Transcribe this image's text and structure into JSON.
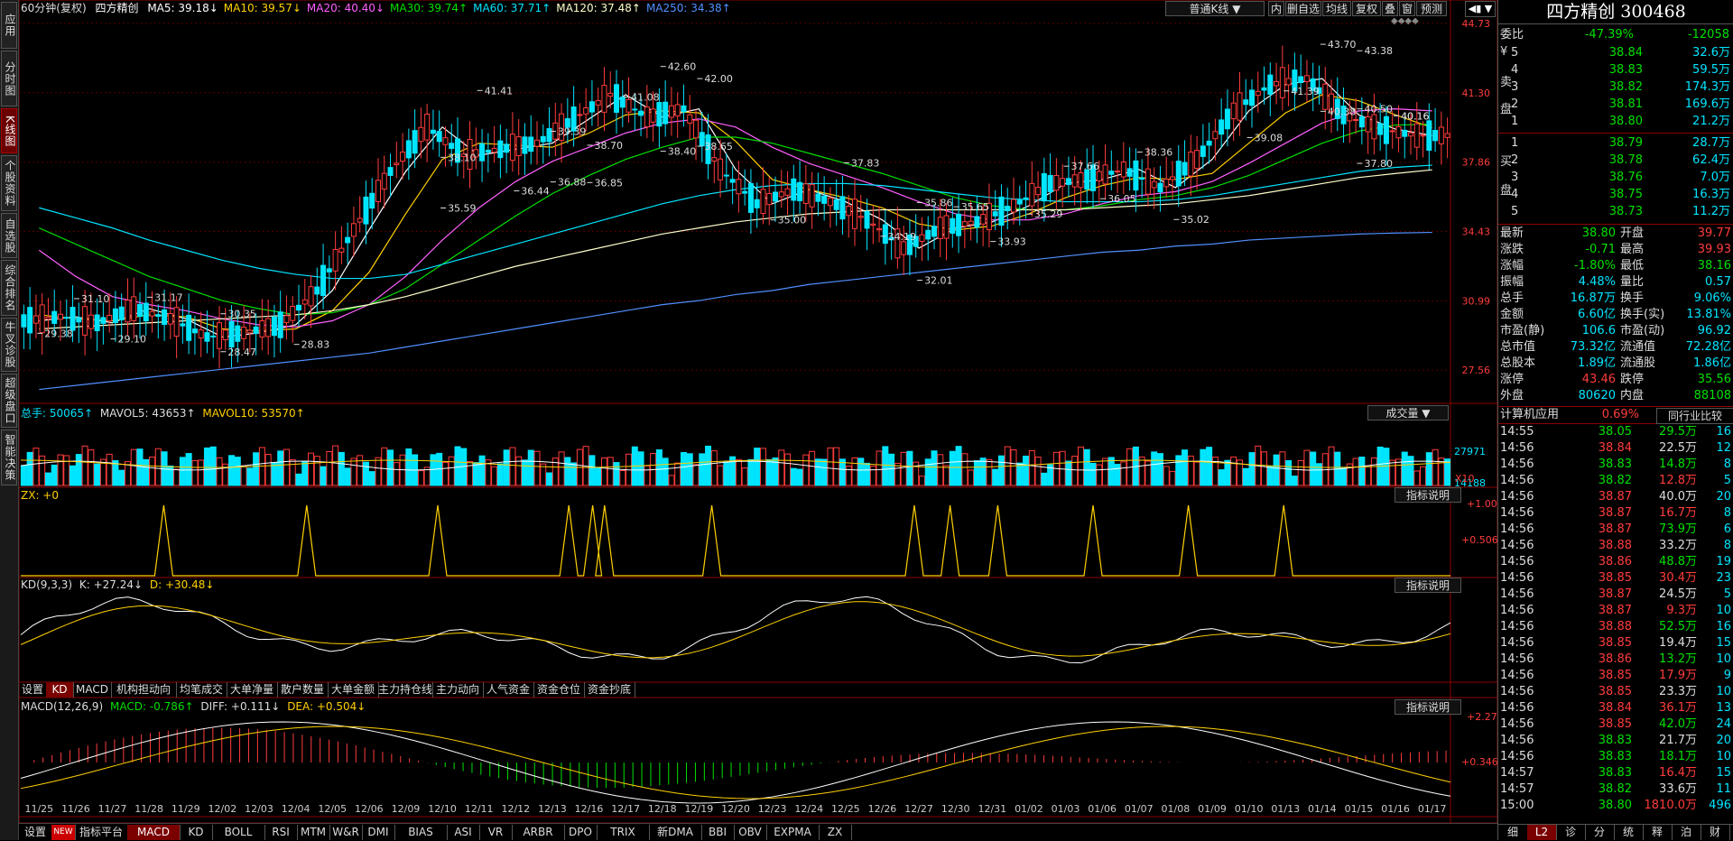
{
  "header": {
    "period": "60分钟(复权)",
    "stock": "四方精创",
    "mas": [
      {
        "label": "MA5: 39.18↓",
        "color": "#ffffff"
      },
      {
        "label": "MA10: 39.57↓",
        "color": "#ffd000"
      },
      {
        "label": "MA20: 40.40↓",
        "color": "#ff60ff"
      },
      {
        "label": "MA30: 39.74↑",
        "color": "#00e000"
      },
      {
        "label": "MA60: 37.71↑",
        "color": "#00e5ff"
      },
      {
        "label": "MA120: 37.48↑",
        "color": "#ffffcc"
      },
      {
        "label": "MA250: 34.38↑",
        "color": "#5090ff"
      }
    ],
    "chart_type": "普通K线",
    "buttons": [
      "内",
      "删自选",
      "均线",
      "复权",
      "叠",
      "窗",
      "预测"
    ],
    "arrow": "◆◆◆◆"
  },
  "left_tabs": [
    "应用",
    "分时图",
    "K线图",
    "个股资料",
    "自选股",
    "综合排名",
    "牛叉诊股",
    "超级盘口",
    "智能决策"
  ],
  "active_left_tab": "K线图",
  "price_axis": [
    "44.73",
    "41.30",
    "37.86",
    "34.43",
    "30.99",
    "27.56"
  ],
  "volume": {
    "label_total": "总手: 50065↑",
    "label_mav5": "MAVOL5: 43653↑",
    "label_mav10": "MAVOL10: 53570↑",
    "selector": "成交量",
    "axis": [
      "27971",
      "14188",
      "X10"
    ]
  },
  "zx": {
    "label": "ZX: +0",
    "desc": "指标说明",
    "axis": [
      "+1.00",
      "+0.506"
    ]
  },
  "kd": {
    "label": "KD(9,3,3)",
    "k": "K: +27.24↓",
    "d": "D: +30.48↓",
    "desc": "指标说明"
  },
  "macd": {
    "label": "MACD(12,26,9)",
    "macd": "MACD: -0.786↑",
    "diff": "DIFF: +0.111↓",
    "dea": "DEA: +0.504↓",
    "desc": "指标说明",
    "axis": [
      "+2.27",
      "+0.346"
    ]
  },
  "indicator_tabs": [
    "设置",
    "KD",
    "MACD",
    "机构担动向",
    "均笔成交",
    "大单净量",
    "散户数量",
    "大单金额",
    "主力持仓线",
    "主力动向",
    "人气资金",
    "资金仓位",
    "资金抄底"
  ],
  "bottom_tabs": [
    "设置",
    "NEW",
    "指标平台",
    "MACD",
    "KD",
    "BOLL",
    "RSI",
    "MTM",
    "W&R",
    "DMI",
    "BIAS",
    "ASI",
    "VR",
    "ARBR",
    "DPO",
    "TRIX",
    "新DMA",
    "BBI",
    "OBV",
    "EXPMA",
    "ZX"
  ],
  "dates": [
    "11/25",
    "11/26",
    "11/27",
    "11/28",
    "11/29",
    "12/02",
    "12/03",
    "12/04",
    "12/05",
    "12/06",
    "12/09",
    "12/10",
    "12/11",
    "12/12",
    "12/13",
    "12/16",
    "12/17",
    "12/18",
    "12/19",
    "12/20",
    "12/23",
    "12/24",
    "12/25",
    "12/26",
    "12/27",
    "12/30",
    "12/31",
    "01/02",
    "01/03",
    "01/06",
    "01/07",
    "01/08",
    "01/09",
    "01/10",
    "01/13",
    "01/14",
    "01/15",
    "01/16",
    "01/17"
  ],
  "price_labels": [
    "29.38",
    "31.10",
    "29.10",
    "31.17",
    "30.35",
    "28.47",
    "28.83",
    "35.59",
    "38.10",
    "41.41",
    "36.44",
    "39.39",
    "36.88",
    "36.85",
    "38.70",
    "41.08",
    "42.60",
    "38.40",
    "42.00",
    "38.65",
    "35.00",
    "37.83",
    "34.19",
    "35.86",
    "32.01",
    "35.65",
    "33.93",
    "35.29",
    "37.66",
    "36.05",
    "38.36",
    "35.02",
    "39.08",
    "41.39",
    "43.70",
    "43.38",
    "40.38",
    "40.16",
    "37.80",
    "40.50",
    "40.16"
  ],
  "chart_data": {
    "type": "line",
    "title": "四方精创 60分钟(复权)",
    "x": [
      "11/25",
      "11/26",
      "11/27",
      "11/28",
      "11/29",
      "12/02",
      "12/03",
      "12/04",
      "12/05",
      "12/06",
      "12/09",
      "12/10",
      "12/11",
      "12/12",
      "12/13",
      "12/16",
      "12/17",
      "12/18",
      "12/19",
      "12/20",
      "12/23",
      "12/24",
      "12/25",
      "12/26",
      "12/27",
      "12/30",
      "12/31",
      "01/02",
      "01/03",
      "01/06",
      "01/07",
      "01/08",
      "01/09",
      "01/10",
      "01/13",
      "01/14",
      "01/15",
      "01/16",
      "01/17"
    ],
    "series": [
      {
        "name": "MA5",
        "values": [
          30.0,
          30.2,
          29.9,
          30.6,
          30.1,
          29.2,
          29.4,
          29.8,
          31.5,
          34.5,
          37.4,
          39.6,
          38.2,
          38.5,
          38.8,
          40.0,
          41.2,
          40.1,
          40.5,
          37.5,
          35.8,
          36.5,
          35.9,
          35.0,
          33.6,
          34.6,
          34.9,
          35.7,
          36.8,
          37.0,
          37.5,
          36.6,
          38.0,
          40.4,
          41.7,
          42.0,
          40.2,
          39.5,
          39.18
        ]
      },
      {
        "name": "MA10",
        "values": [
          30.3,
          30.1,
          30.0,
          30.3,
          30.2,
          29.6,
          29.5,
          29.6,
          30.5,
          32.4,
          35.3,
          38.0,
          38.8,
          38.7,
          38.6,
          39.3,
          40.2,
          40.4,
          40.3,
          38.9,
          37.0,
          36.5,
          36.1,
          35.6,
          34.8,
          34.5,
          34.7,
          35.3,
          36.1,
          36.7,
          37.1,
          37.0,
          37.3,
          38.8,
          40.3,
          41.2,
          40.9,
          40.2,
          39.57
        ]
      },
      {
        "name": "MA20",
        "values": [
          33.5,
          32.2,
          31.2,
          30.8,
          30.5,
          30.1,
          29.8,
          29.7,
          30.0,
          30.8,
          32.2,
          34.0,
          35.6,
          36.9,
          37.9,
          38.6,
          39.3,
          39.8,
          40.0,
          39.6,
          38.6,
          37.8,
          37.2,
          36.6,
          35.9,
          35.3,
          35.0,
          35.0,
          35.3,
          35.8,
          36.2,
          36.4,
          36.9,
          37.8,
          38.8,
          39.8,
          40.4,
          40.5,
          40.4
        ]
      },
      {
        "name": "MA30",
        "values": [
          34.6,
          33.8,
          33.0,
          32.2,
          31.6,
          31.0,
          30.6,
          30.3,
          30.4,
          30.8,
          31.6,
          32.8,
          34.0,
          35.2,
          36.3,
          37.2,
          38.0,
          38.6,
          39.1,
          39.1,
          38.8,
          38.3,
          37.8,
          37.3,
          36.7,
          36.1,
          35.7,
          35.5,
          35.5,
          35.7,
          36.0,
          36.2,
          36.6,
          37.2,
          38.0,
          38.8,
          39.4,
          39.7,
          39.74
        ]
      },
      {
        "name": "MA60",
        "values": [
          35.6,
          35.1,
          34.6,
          34.0,
          33.5,
          33.0,
          32.6,
          32.3,
          32.1,
          32.1,
          32.3,
          32.8,
          33.3,
          33.8,
          34.3,
          34.8,
          35.3,
          35.8,
          36.2,
          36.5,
          36.7,
          36.8,
          36.8,
          36.7,
          36.5,
          36.3,
          36.1,
          36.0,
          35.9,
          35.9,
          35.9,
          36.0,
          36.2,
          36.5,
          36.8,
          37.1,
          37.4,
          37.6,
          37.71
        ]
      },
      {
        "name": "MA120",
        "values": [
          29.6,
          29.7,
          29.8,
          29.9,
          30.0,
          30.1,
          30.2,
          30.3,
          30.5,
          30.8,
          31.2,
          31.7,
          32.2,
          32.7,
          33.1,
          33.5,
          33.9,
          34.3,
          34.6,
          34.9,
          35.1,
          35.3,
          35.4,
          35.5,
          35.5,
          35.5,
          35.5,
          35.5,
          35.5,
          35.6,
          35.7,
          35.8,
          36.0,
          36.2,
          36.5,
          36.8,
          37.1,
          37.3,
          37.48
        ]
      },
      {
        "name": "MA250",
        "values": [
          26.6,
          26.8,
          27.0,
          27.2,
          27.4,
          27.6,
          27.8,
          28.0,
          28.2,
          28.4,
          28.7,
          29.0,
          29.3,
          29.6,
          29.9,
          30.2,
          30.5,
          30.8,
          31.0,
          31.3,
          31.5,
          31.8,
          32.0,
          32.2,
          32.4,
          32.6,
          32.8,
          33.0,
          33.2,
          33.4,
          33.5,
          33.7,
          33.8,
          34.0,
          34.1,
          34.2,
          34.3,
          34.35,
          34.38
        ]
      }
    ],
    "ylim": [
      26.0,
      45.0
    ]
  },
  "right": {
    "title": "四方精创 300468",
    "weibi": {
      "label": "委比",
      "pct": "-47.39%",
      "diff": "-12058"
    },
    "sell": [
      {
        "n": "5",
        "price": "38.84",
        "vol": "32.6万"
      },
      {
        "n": "4",
        "price": "38.83",
        "vol": "59.5万"
      },
      {
        "n": "3",
        "price": "38.82",
        "vol": "174.3万"
      },
      {
        "n": "2",
        "price": "38.81",
        "vol": "169.6万"
      },
      {
        "n": "1",
        "price": "38.80",
        "vol": "21.2万"
      }
    ],
    "buy": [
      {
        "n": "1",
        "price": "38.79",
        "vol": "28.7万"
      },
      {
        "n": "2",
        "price": "38.78",
        "vol": "62.4万"
      },
      {
        "n": "3",
        "price": "38.76",
        "vol": "7.0万"
      },
      {
        "n": "4",
        "price": "38.75",
        "vol": "16.3万"
      },
      {
        "n": "5",
        "price": "38.73",
        "vol": "11.2万"
      }
    ],
    "sell_label": [
      "¥",
      "卖",
      "盘"
    ],
    "buy_label": [
      "买",
      "盘"
    ],
    "stats": [
      [
        "最新",
        "38.80",
        "开盘",
        "39.77"
      ],
      [
        "涨跌",
        "-0.71",
        "最高",
        "39.93"
      ],
      [
        "涨幅",
        "-1.80%",
        "最低",
        "38.16"
      ],
      [
        "振幅",
        "4.48%",
        "量比",
        "0.57"
      ],
      [
        "总手",
        "16.87万",
        "换手",
        "9.06%"
      ],
      [
        "金额",
        "6.60亿",
        "换手(实)",
        "13.81%"
      ],
      [
        "市盈(静)",
        "106.6",
        "市盈(动)",
        "96.92"
      ],
      [
        "总市值",
        "73.32亿",
        "流通值",
        "72.28亿"
      ],
      [
        "总股本",
        "1.89亿",
        "流通股",
        "1.86亿"
      ],
      [
        "涨停",
        "43.46",
        "跌停",
        "35.56"
      ],
      [
        "外盘",
        "80620",
        "内盘",
        "88108"
      ]
    ],
    "industry": {
      "name": "计算机应用",
      "pct": "0.69%",
      "btn": "同行业比较"
    },
    "ticks": [
      [
        "14:55",
        "38.05",
        "29.5万",
        "16"
      ],
      [
        "14:56",
        "38.84",
        "22.5万",
        "12"
      ],
      [
        "14:56",
        "38.83",
        "14.8万",
        "8"
      ],
      [
        "14:56",
        "38.82",
        "12.8万",
        "5"
      ],
      [
        "14:56",
        "38.87",
        "40.0万",
        "20"
      ],
      [
        "14:56",
        "38.87",
        "16.7万",
        "8"
      ],
      [
        "14:56",
        "38.87",
        "73.9万",
        "6"
      ],
      [
        "14:56",
        "38.88",
        "33.2万",
        "8"
      ],
      [
        "14:56",
        "38.86",
        "48.8万",
        "19"
      ],
      [
        "14:56",
        "38.85",
        "30.4万",
        "23"
      ],
      [
        "14:56",
        "38.87",
        "24.5万",
        "5"
      ],
      [
        "14:56",
        "38.87",
        "9.3万",
        "10"
      ],
      [
        "14:56",
        "38.88",
        "52.5万",
        "16"
      ],
      [
        "14:56",
        "38.85",
        "19.4万",
        "15"
      ],
      [
        "14:56",
        "38.86",
        "13.2万",
        "10"
      ],
      [
        "14:56",
        "38.85",
        "17.9万",
        "9"
      ],
      [
        "14:56",
        "38.85",
        "23.3万",
        "10"
      ],
      [
        "14:56",
        "38.84",
        "36.1万",
        "13"
      ],
      [
        "14:56",
        "38.85",
        "42.0万",
        "24"
      ],
      [
        "14:56",
        "38.83",
        "21.7万",
        "20"
      ],
      [
        "14:56",
        "38.83",
        "18.1万",
        "10"
      ],
      [
        "14:57",
        "38.83",
        "16.4万",
        "15"
      ],
      [
        "14:57",
        "38.82",
        "33.6万",
        "11"
      ],
      [
        "15:00",
        "38.80",
        "1810.0万",
        "496"
      ]
    ],
    "bottom_tabs": [
      "细",
      "L2",
      "诊",
      "分",
      "统",
      "释",
      "泊",
      "财"
    ]
  }
}
